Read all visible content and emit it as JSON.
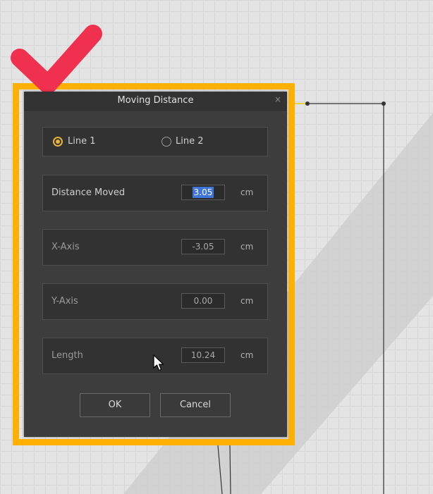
{
  "dialog": {
    "title": "Moving Distance",
    "close_glyph": "×",
    "radio": [
      {
        "label": "Line 1",
        "checked": true
      },
      {
        "label": "Line 2",
        "checked": false
      }
    ],
    "fields": {
      "distance": {
        "label": "Distance Moved",
        "value": "3.05",
        "unit": "cm",
        "selected": true
      },
      "x_axis": {
        "label": "X-Axis",
        "value": "-3.05",
        "unit": "cm"
      },
      "y_axis": {
        "label": "Y-Axis",
        "value": "0.00",
        "unit": "cm"
      },
      "length": {
        "label": "Length",
        "value": "10.24",
        "unit": "cm"
      }
    },
    "buttons": {
      "ok": "OK",
      "cancel": "Cancel"
    }
  },
  "colors": {
    "highlight": "#ffb000",
    "checkmark": "#f0304f",
    "radio_accent": "#e8b43a",
    "selection": "#3e75d6"
  },
  "icons": [
    "checkmark-icon",
    "close-icon",
    "radio-checked-icon",
    "radio-unchecked-icon",
    "mouse-cursor-icon"
  ]
}
